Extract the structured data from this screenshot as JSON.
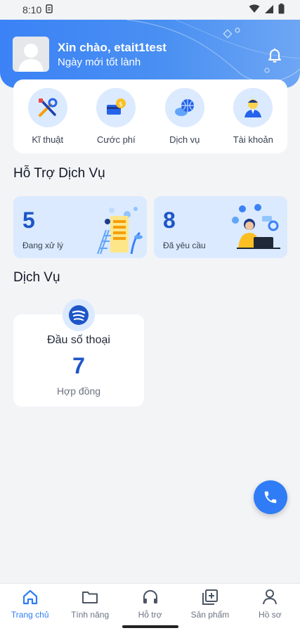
{
  "status_bar": {
    "time": "8:10"
  },
  "header": {
    "greeting": "Xin chào, etait1test",
    "subtitle": "Ngày mới tốt lành"
  },
  "quick_actions": [
    {
      "label": "Kĩ thuật",
      "icon": "tools-icon"
    },
    {
      "label": "Cước phí",
      "icon": "payment-icon"
    },
    {
      "label": "Dịch vụ",
      "icon": "cloud-globe-icon"
    },
    {
      "label": "Tài khoản",
      "icon": "account-icon"
    }
  ],
  "support": {
    "title": "Hỗ Trợ Dịch Vụ",
    "cards": [
      {
        "value": "5",
        "label": "Đang xử lý"
      },
      {
        "value": "8",
        "label": "Đã yêu cầu"
      }
    ]
  },
  "services": {
    "title": "Dịch Vụ",
    "cards": [
      {
        "name": "Đầu số thoại",
        "value": "7",
        "sub": "Hợp đồng",
        "icon": "phone-number-icon"
      }
    ]
  },
  "bottom_nav": [
    {
      "label": "Trang chủ",
      "icon": "home-icon",
      "active": true
    },
    {
      "label": "Tính năng",
      "icon": "folder-icon",
      "active": false
    },
    {
      "label": "Hỗ trợ",
      "icon": "headset-icon",
      "active": false
    },
    {
      "label": "Sản phẩm",
      "icon": "add-box-icon",
      "active": false
    },
    {
      "label": "Hồ sơ",
      "icon": "person-icon",
      "active": false
    }
  ],
  "colors": {
    "primary": "#2f7cf6",
    "accent_dark": "#1e56c8",
    "card_tint": "#dbeafe",
    "background": "#f3f4f6"
  }
}
